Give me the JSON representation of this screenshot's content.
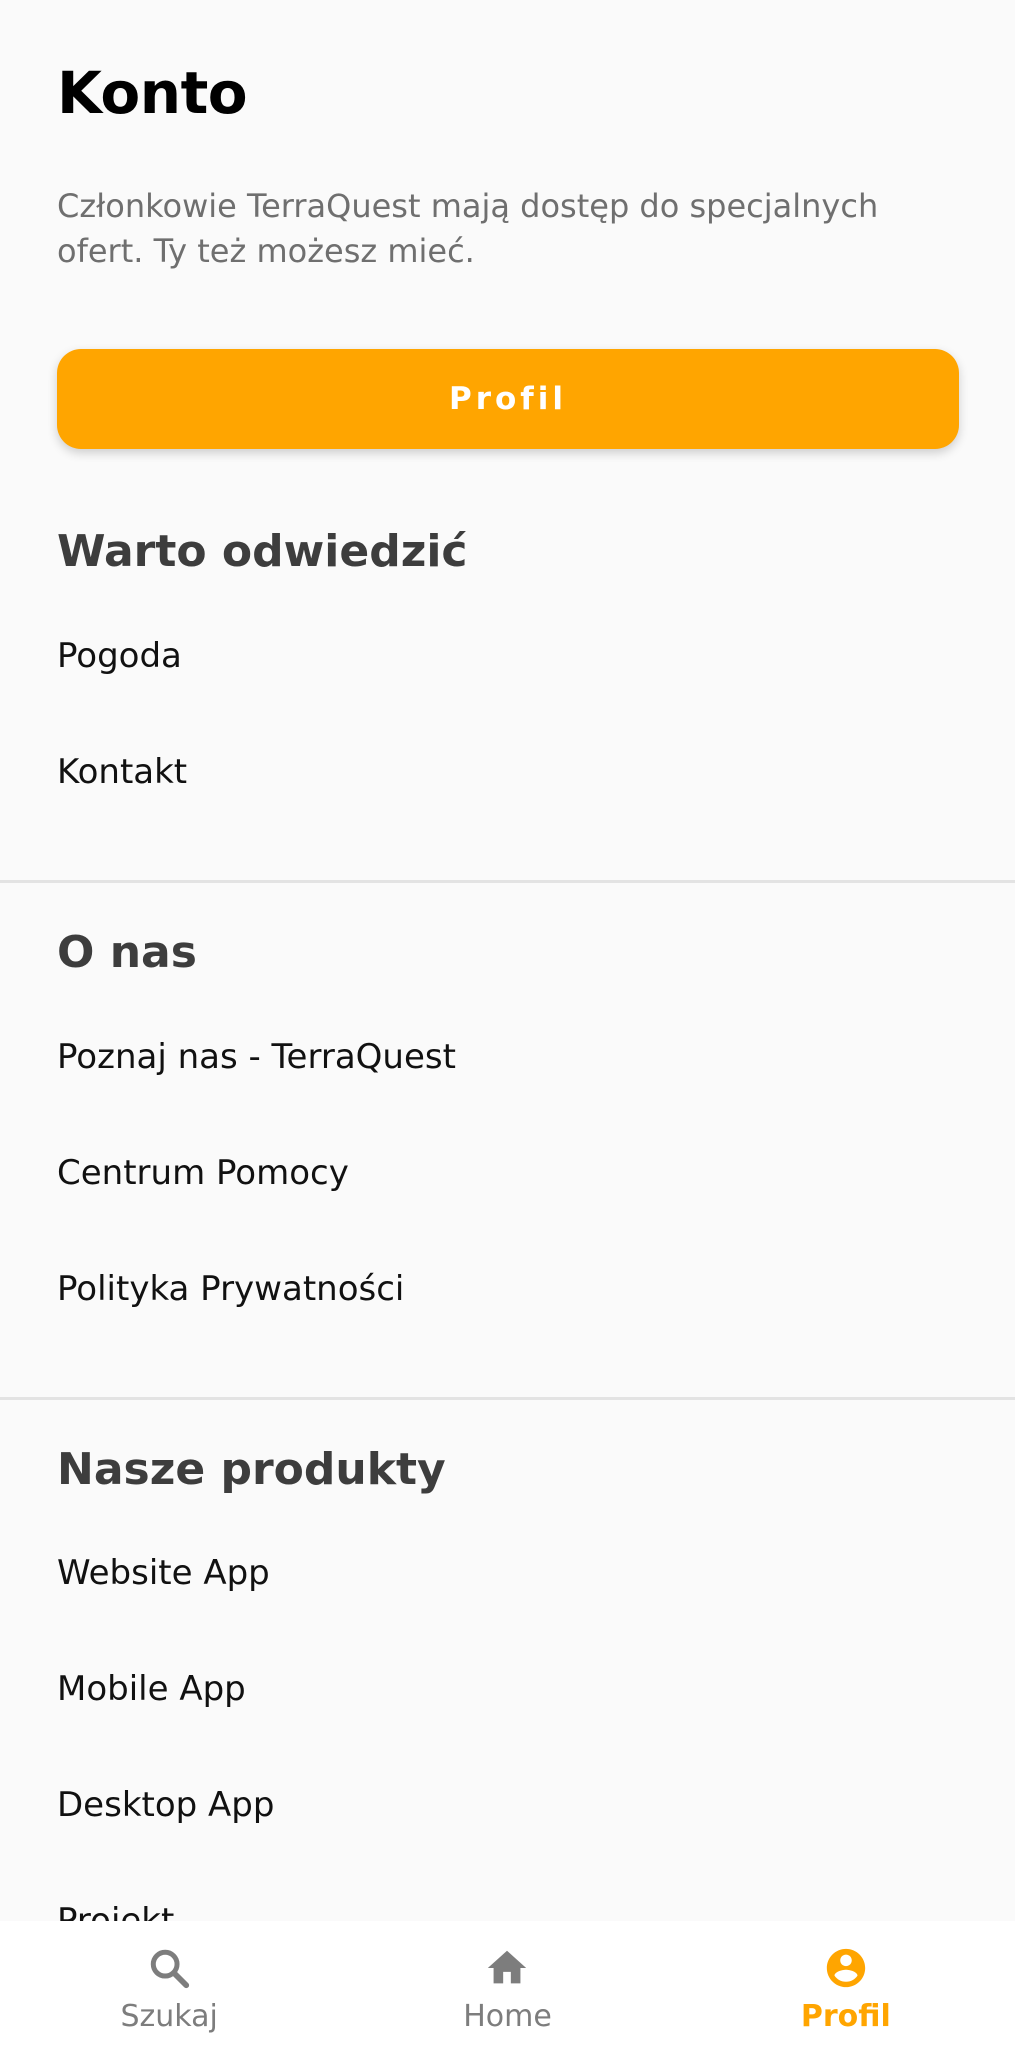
{
  "page": {
    "title": "Konto",
    "intro": "Członkowie TerraQuest mają dostęp do specjalnych ofert. Ty też możesz mieć."
  },
  "profile_button": {
    "label": "Profil",
    "color": "#FFA500"
  },
  "sections": [
    {
      "title": "Warto odwiedzić",
      "items": [
        "Pogoda",
        "Kontakt"
      ]
    },
    {
      "title": "O nas",
      "items": [
        "Poznaj nas - TerraQuest",
        "Centrum Pomocy",
        "Polityka Prywatności"
      ]
    },
    {
      "title": "Nasze produkty",
      "items": [
        "Website App",
        "Mobile App",
        "Desktop App",
        "Projekt"
      ]
    }
  ],
  "bottom_nav": {
    "items": [
      {
        "label": "Szukaj",
        "icon": "search-icon",
        "active": false
      },
      {
        "label": "Home",
        "icon": "home-icon",
        "active": false
      },
      {
        "label": "Profil",
        "icon": "account-circle-icon",
        "active": true
      }
    ],
    "active_color": "#FFA500",
    "inactive_color": "#7D7D7D"
  }
}
